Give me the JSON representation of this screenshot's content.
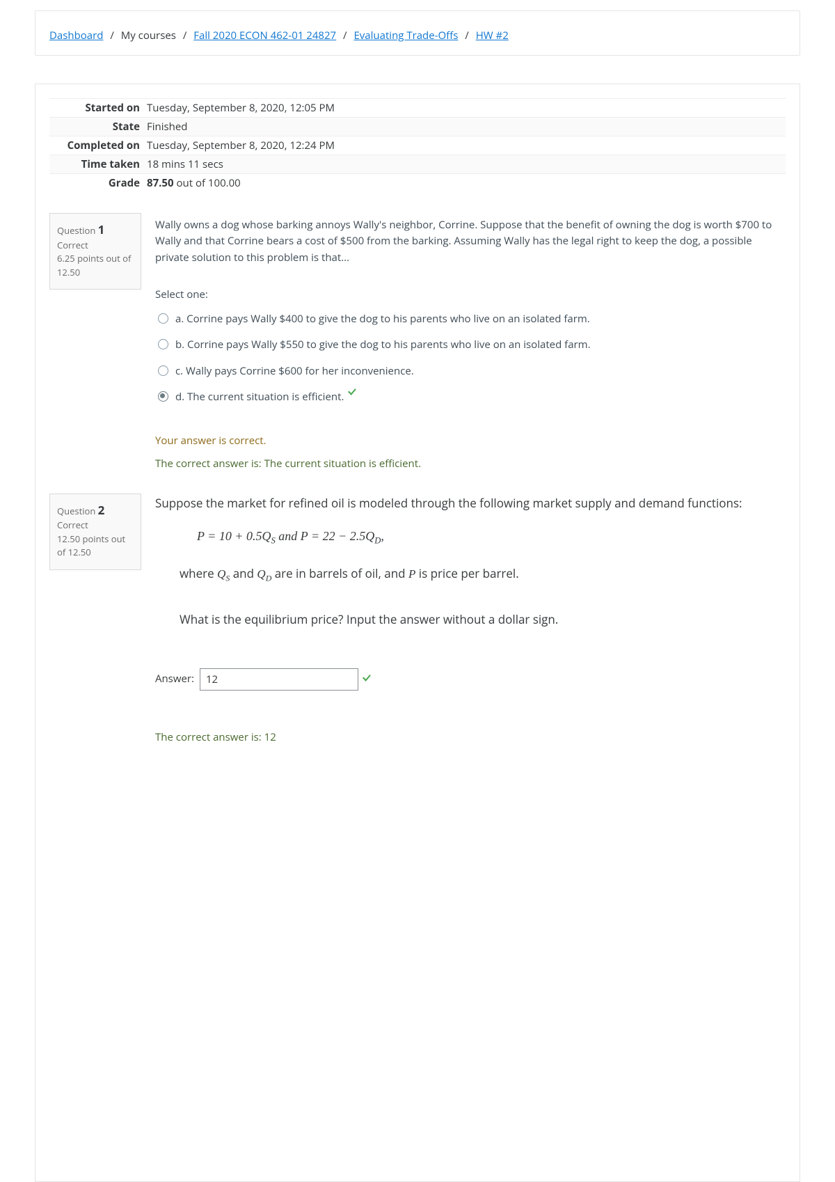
{
  "breadcrumb": {
    "dashboard": "Dashboard",
    "mycourses": "My courses",
    "course": "Fall 2020 ECON 462-01 24827",
    "section": "Evaluating Trade-Offs",
    "activity": "HW #2"
  },
  "summary": {
    "started_label": "Started on",
    "started_val": "Tuesday, September 8, 2020, 12:05 PM",
    "state_label": "State",
    "state_val": "Finished",
    "completed_label": "Completed on",
    "completed_val": "Tuesday, September 8, 2020, 12:24 PM",
    "time_label": "Time taken",
    "time_val": "18 mins 11 secs",
    "grade_label": "Grade",
    "grade_strong": "87.50",
    "grade_rest": " out of 100.00"
  },
  "q1": {
    "label": "Question ",
    "num": "1",
    "status": "Correct",
    "points": "6.25 points out of 12.50",
    "stem": "Wally owns a dog whose barking annoys Wally's neighbor, Corrine. Suppose that the benefit of owning the dog is worth $700 to Wally and that Corrine bears a cost of $500 from the barking. Assuming Wally has the legal right to keep the dog, a possible private solution to this problem is that...",
    "prompt": "Select one:",
    "a": "a. Corrine pays Wally $400 to give the dog to his parents who live on an isolated farm.",
    "b": "b. Corrine pays Wally $550 to give the dog to his parents who live on an isolated farm.",
    "c": "c. Wally pays Corrine $600 for her inconvenience.",
    "d": "d. The current situation is efficient.",
    "fb1": "Your answer is correct.",
    "fb2_pre": "The correct answer is: ",
    "fb2_ans": "The current situation is efficient."
  },
  "q2": {
    "label": "Question ",
    "num": "2",
    "status": "Correct",
    "points": "12.50 points out of 12.50",
    "intro": "Suppose the market for refined oil is modeled through the following market supply and demand functions:",
    "where_pre": "where ",
    "where_mid": " and ",
    "where_post": " are in barrels of oil, and ",
    "where_end": " is price per barrel.",
    "ask": "What is the equilibrium price? Input the answer without a dollar sign.",
    "answer_label": "Answer:",
    "answer_val": "12",
    "fb": "The correct answer is: 12"
  }
}
